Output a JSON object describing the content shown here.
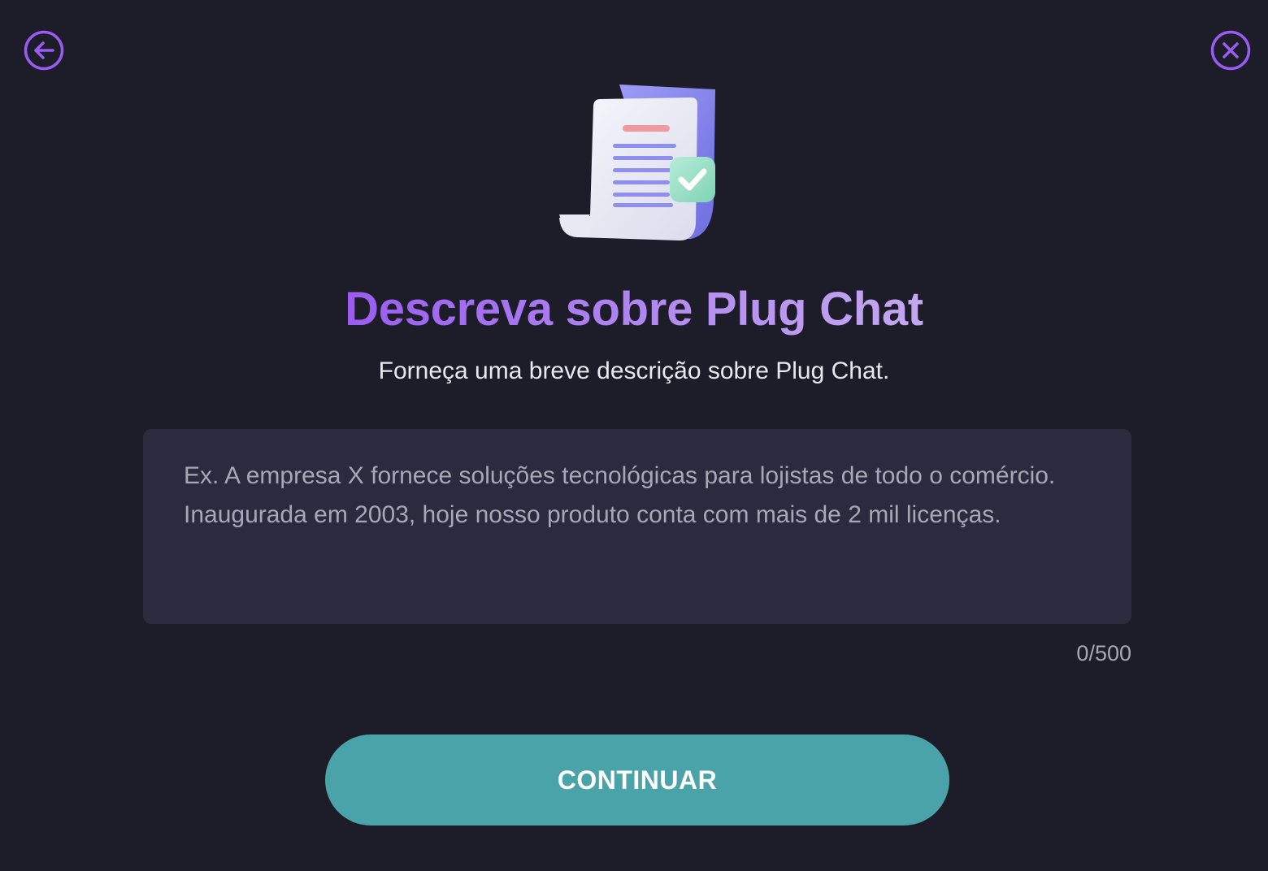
{
  "colors": {
    "background": "#1c1d29",
    "accent_purple": "#9a5cf0",
    "input_background": "#2a2b3e",
    "button_teal": "#4aa3a8",
    "muted_text": "#a7a8b6"
  },
  "nav": {
    "back_icon": "arrow-left-circle-icon",
    "close_icon": "x-circle-icon"
  },
  "illustration": {
    "icon": "document-checkmark-icon"
  },
  "header": {
    "title": "Descreva sobre Plug Chat",
    "subtitle": "Forneça uma breve descrição sobre Plug Chat."
  },
  "description": {
    "value": "",
    "placeholder": "Ex. A empresa X fornece soluções tecnológicas para lojistas de todo o comércio. Inaugurada em 2003, hoje nosso produto conta com mais de 2 mil licenças.",
    "counter": "0/500"
  },
  "actions": {
    "continue_label": "CONTINUAR"
  }
}
